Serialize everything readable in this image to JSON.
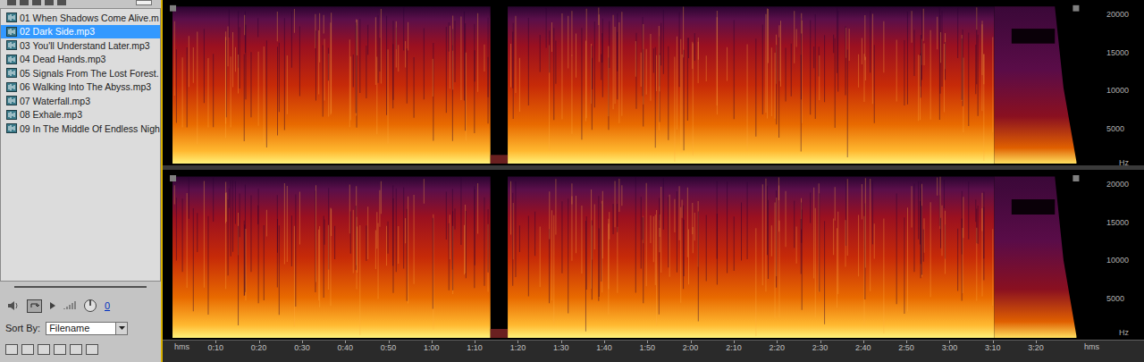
{
  "files": [
    {
      "name": "01 When Shadows Come Alive.m",
      "selected": false
    },
    {
      "name": "02 Dark Side.mp3",
      "selected": true
    },
    {
      "name": "03 You'll Understand Later.mp3",
      "selected": false
    },
    {
      "name": "04 Dead Hands.mp3",
      "selected": false
    },
    {
      "name": "05 Signals From The Lost Forest.",
      "selected": false
    },
    {
      "name": "06 Walking Into The Abyss.mp3",
      "selected": false
    },
    {
      "name": "07 Waterfall.mp3",
      "selected": false
    },
    {
      "name": "08 Exhale.mp3",
      "selected": false
    },
    {
      "name": "09 In The Middle Of Endless Nigh",
      "selected": false
    }
  ],
  "transport": {
    "loop": true,
    "volume_reading": "0"
  },
  "sort": {
    "label": "Sort By:",
    "value": "Filename"
  },
  "spectrogram": {
    "channels": [
      {
        "frequency_labels": [
          {
            "text": "20000",
            "hz": 20000
          },
          {
            "text": "15000",
            "hz": 15000
          },
          {
            "text": "10000",
            "hz": 10000
          },
          {
            "text": "5000",
            "hz": 5000
          }
        ],
        "unit": "Hz"
      },
      {
        "frequency_labels": [
          {
            "text": "20000",
            "hz": 20000
          },
          {
            "text": "15000",
            "hz": 15000
          },
          {
            "text": "10000",
            "hz": 10000
          },
          {
            "text": "5000",
            "hz": 5000
          }
        ],
        "unit": "Hz"
      }
    ],
    "duration_seconds": 209,
    "silent_ranges": [
      [
        73.5,
        77.5
      ]
    ],
    "cutoff_from_seconds": 190,
    "time_axis": {
      "unit": "hms",
      "end_unit": "hms",
      "ticks": [
        {
          "text": "0:10",
          "seconds": 10
        },
        {
          "text": "0:20",
          "seconds": 20
        },
        {
          "text": "0:30",
          "seconds": 30
        },
        {
          "text": "0:40",
          "seconds": 40
        },
        {
          "text": "0:50",
          "seconds": 50
        },
        {
          "text": "1:00",
          "seconds": 60
        },
        {
          "text": "1:10",
          "seconds": 70
        },
        {
          "text": "1:20",
          "seconds": 80
        },
        {
          "text": "1:30",
          "seconds": 90
        },
        {
          "text": "1:40",
          "seconds": 100
        },
        {
          "text": "1:50",
          "seconds": 110
        },
        {
          "text": "2:00",
          "seconds": 120
        },
        {
          "text": "2:10",
          "seconds": 130
        },
        {
          "text": "2:20",
          "seconds": 140
        },
        {
          "text": "2:30",
          "seconds": 150
        },
        {
          "text": "2:40",
          "seconds": 160
        },
        {
          "text": "2:50",
          "seconds": 170
        },
        {
          "text": "3:00",
          "seconds": 180
        },
        {
          "text": "3:10",
          "seconds": 190
        },
        {
          "text": "3:20",
          "seconds": 200
        }
      ]
    }
  }
}
